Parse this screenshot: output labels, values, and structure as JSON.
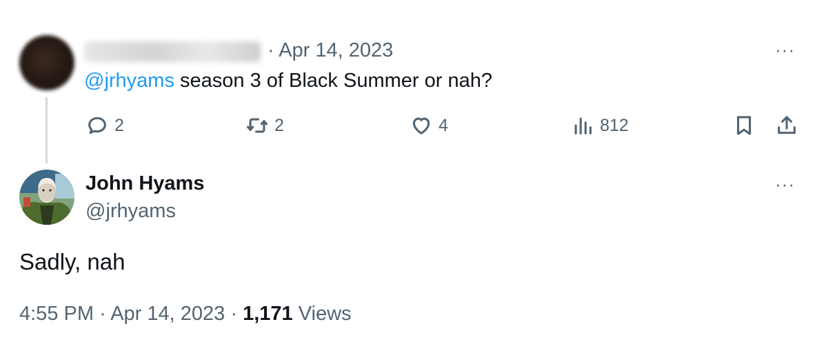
{
  "original_tweet": {
    "date": "Apr 14, 2023",
    "separator": "·",
    "mention": "@jrhyams",
    "text": " season 3 of Black Summer or nah?",
    "more": "···",
    "actions": {
      "replies": "2",
      "retweets": "2",
      "likes": "4",
      "views": "812"
    },
    "icons": [
      "reply-icon",
      "retweet-icon",
      "like-icon",
      "views-icon",
      "bookmark-icon",
      "share-icon"
    ]
  },
  "reply_tweet": {
    "name": "John Hyams",
    "handle": "@jrhyams",
    "more": "···",
    "text": "Sadly, nah",
    "time": "4:55 PM",
    "date": "Apr 14, 2023",
    "views_count": "1,171",
    "views_label": "Views",
    "separator": "·"
  },
  "colors": {
    "text": "#0f1419",
    "muted": "#536471",
    "accent": "#1d9bf0",
    "thread_line": "#cfd9de"
  }
}
